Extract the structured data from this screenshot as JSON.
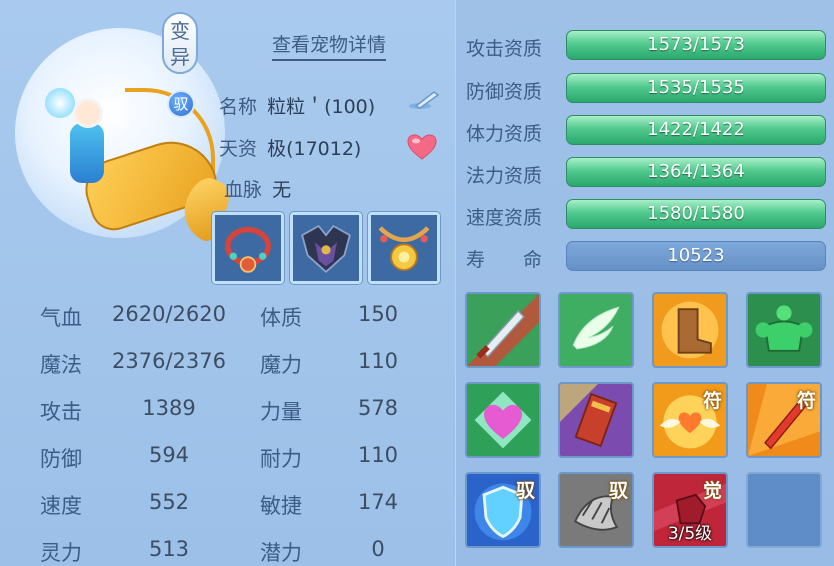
{
  "pet": {
    "badge_variant": "变异",
    "badge_ride": "驭",
    "detail_link": "查看宠物详情",
    "name_label": "名称",
    "name_value": "粒粒＇(100)",
    "talent_label": "天资",
    "talent_value": "极(17012)",
    "bloodline_label": "血脉",
    "bloodline_value": "无"
  },
  "stats": [
    {
      "label": "气血",
      "value": "2620/2620",
      "label2": "体质",
      "value2": "150"
    },
    {
      "label": "魔法",
      "value": "2376/2376",
      "label2": "魔力",
      "value2": "110"
    },
    {
      "label": "攻击",
      "value": "1389",
      "label2": "力量",
      "value2": "578"
    },
    {
      "label": "防御",
      "value": "594",
      "label2": "耐力",
      "value2": "110"
    },
    {
      "label": "速度",
      "value": "552",
      "label2": "敏捷",
      "value2": "174"
    },
    {
      "label": "灵力",
      "value": "513",
      "label2": "潜力",
      "value2": "0"
    }
  ],
  "aptitudes": [
    {
      "label": "攻击资质",
      "value": "1573/1573"
    },
    {
      "label": "防御资质",
      "value": "1535/1535"
    },
    {
      "label": "体力资质",
      "value": "1422/1422"
    },
    {
      "label": "法力资质",
      "value": "1364/1364"
    },
    {
      "label": "速度资质",
      "value": "1580/1580"
    }
  ],
  "life": {
    "label": "寿　　命",
    "value": "10523"
  },
  "skills": {
    "tag_fu": "符",
    "tag_yu": "驭",
    "tag_jue": "觉",
    "level": "3/5级"
  },
  "icons": {
    "equip": [
      "necklace-icon",
      "armor-icon",
      "amulet-icon"
    ],
    "skills": [
      "sword-icon",
      "wings-icon",
      "boot-icon",
      "muscle-icon",
      "heart-icon",
      "scroll-icon",
      "winged-heart-icon",
      "flaming-sword-icon",
      "shield-icon",
      "claw-icon",
      "fist-icon"
    ]
  },
  "colors": {
    "bar_green": "#52c98f",
    "bar_blue": "#6691c7",
    "label_blue": "#3b5d86"
  }
}
